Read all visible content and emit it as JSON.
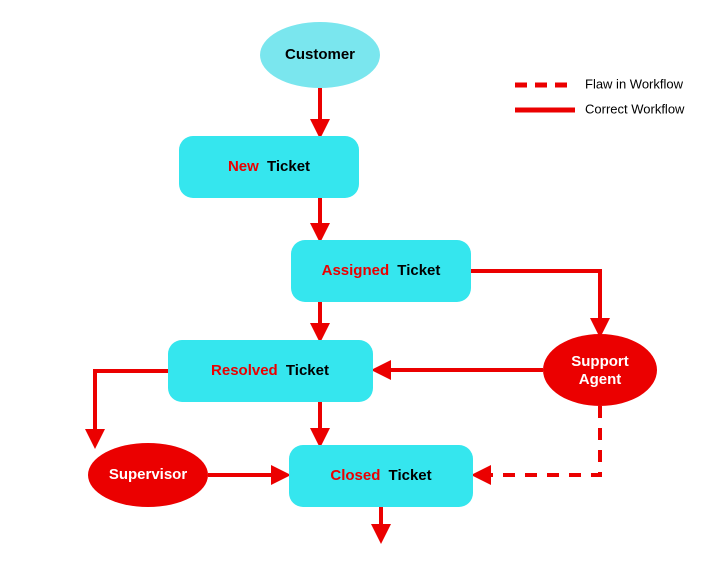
{
  "actors": {
    "customer": "Customer",
    "support_agent_l1": "Support",
    "support_agent_l2": "Agent",
    "supervisor": "Supervisor"
  },
  "tickets": {
    "new": {
      "status": "New",
      "noun": "Ticket"
    },
    "assigned": {
      "status": "Assigned",
      "noun": "Ticket"
    },
    "resolved": {
      "status": "Resolved",
      "noun": "Ticket"
    },
    "closed": {
      "status": "Closed",
      "noun": "Ticket"
    }
  },
  "legend": {
    "flaw": "Flaw in Workflow",
    "correct": "Correct Workflow"
  }
}
